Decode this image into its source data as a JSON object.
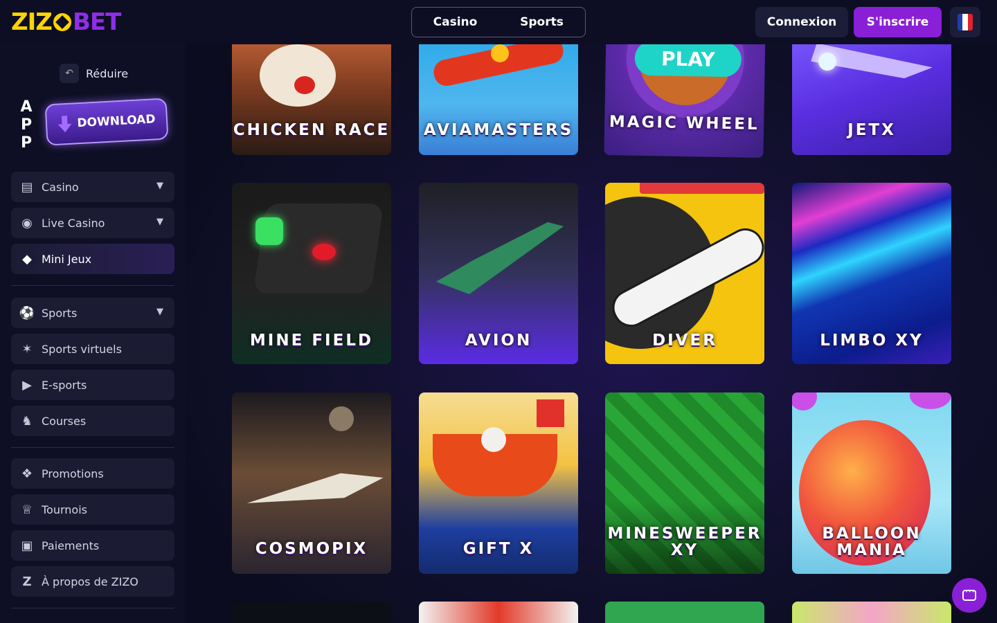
{
  "header": {
    "logo_left": "ZIZ",
    "logo_right": "BET",
    "nav": [
      "Casino",
      "Sports"
    ],
    "login": "Connexion",
    "signup": "S'inscrire",
    "language_flag": "flag-fr-icon"
  },
  "sidebar": {
    "reduce_label": "Réduire",
    "app_letters": [
      "A",
      "P",
      "P"
    ],
    "download_label": "DOWNLOAD",
    "items": [
      {
        "label": "Casino",
        "icon": "slot-machine-icon",
        "has_chevron": true
      },
      {
        "label": "Live Casino",
        "icon": "live-casino-icon",
        "has_chevron": true
      },
      {
        "label": "Mini Jeux",
        "icon": "diamond-icon",
        "active": true
      },
      {
        "label": "Sports",
        "icon": "soccer-ball-icon",
        "has_chevron": true
      },
      {
        "label": "Sports virtuels",
        "icon": "virtual-sports-icon"
      },
      {
        "label": "E-sports",
        "icon": "play-icon"
      },
      {
        "label": "Courses",
        "icon": "horse-icon"
      },
      {
        "label": "Promotions",
        "icon": "megaphone-icon"
      },
      {
        "label": "Tournois",
        "icon": "trophy-icon"
      },
      {
        "label": "Paiements",
        "icon": "wallet-icon"
      },
      {
        "label": "À propos de ZIZO",
        "icon": "zizo-logo-icon"
      }
    ]
  },
  "games": {
    "row1": [
      "CHICKEN RACE",
      "AVIAMASTERS",
      "MAGIC WHEEL",
      "JETX"
    ],
    "row1_extra": "PLAY",
    "row2": [
      "MINE FIELD",
      "AVION",
      "DIVER",
      "LIMBO XY"
    ],
    "row3": [
      "COSMOPIX",
      "GIFT X",
      "MINESWEEPER XY",
      "BALLOON MANIA"
    ],
    "row3_split": {
      "minesweeper": [
        "MINESWEEPER",
        "XY"
      ],
      "balloon": [
        "BALLOON",
        "MANIA"
      ]
    }
  },
  "colors": {
    "accent": "#8a1fd8",
    "logo_yellow": "#ffd400",
    "background": "#0b0c1f"
  }
}
